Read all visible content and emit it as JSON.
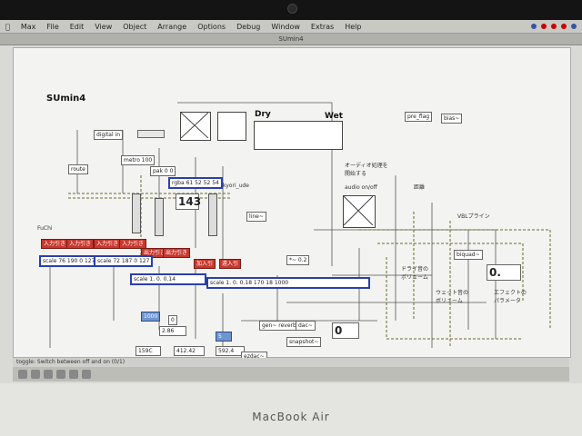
{
  "app": {
    "menus": [
      "Max",
      "File",
      "Edit",
      "View",
      "Object",
      "Arrange",
      "Options",
      "Debug",
      "Window",
      "Extras",
      "Help"
    ],
    "window_title": "SUmin4"
  },
  "patch": {
    "title": "SUmin4",
    "labels": {
      "dry": "Dry",
      "wet": "Wet",
      "fuchi": "FuChi",
      "audio_onoff": "audio on/off",
      "kyori": "kyori_ude",
      "channel_label": "オーディオ処理を\n開始する",
      "vbl": "VBLプライン",
      "volume": "ドライ音の\nボリューム",
      "wet_volume": "ウェット音の\nボリューム",
      "effect": "エフェクトの\nパラメータ",
      "kyori_label": "距離"
    },
    "objects": {
      "rgba": "rgba 61 52 52 54",
      "scale_a": "scale 76 190 0 127",
      "scale_b": "scale 72 187 0 127",
      "scale_c": "scale",
      "scale_c_args": "1. 0. 0.14",
      "scale_d": "scale",
      "scale_d_args": "1. 0. 0.18 170 18 1000",
      "num_143": "143",
      "num_0": "0",
      "num_0b": "0.",
      "num_286": "2.86",
      "num_412": "412.42",
      "num_5924": "592.4",
      "num_159": "159C",
      "num_5": "5",
      "num_1000": "1000",
      "toggle_metro": "metro 100",
      "pak": "pak 0 0",
      "dac": "dac~",
      "pre_flag": "pre_flag",
      "verb": "gen~ reverb",
      "line": "line~",
      "mul": "*~ 0.2",
      "snapshot": "snapshot~",
      "ezdac": "ezdac~",
      "biquad": "biquad~",
      "bias": "bias~"
    },
    "red_buttons": [
      "入力引き",
      "入力引き",
      "入力引き",
      "入力引き",
      "出力引き",
      "出力引き",
      "加入引",
      "遠入引"
    ]
  },
  "status": {
    "hint": "toggle: Switch between off and on (0/1)"
  },
  "laptop": {
    "brand": "MacBook Air"
  }
}
